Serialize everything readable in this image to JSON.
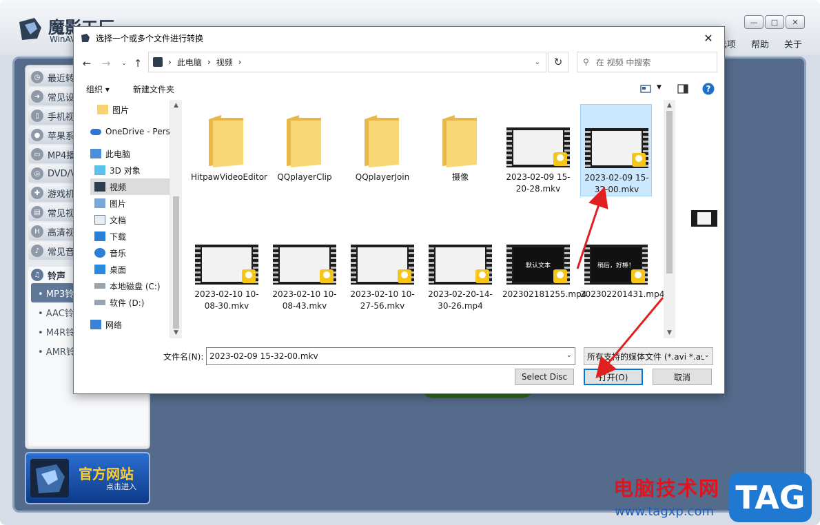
{
  "app": {
    "title": "魔影工厂",
    "subtitle": "WinAV",
    "menu": [
      "选项",
      "帮助",
      "关于"
    ],
    "window_controls": [
      "minimize",
      "maximize",
      "close"
    ],
    "sidebar": [
      {
        "label": "最近转",
        "icon": "clock-icon"
      },
      {
        "label": "常见设",
        "icon": "arrow-icon"
      },
      {
        "label": "手机视",
        "icon": "phone-icon"
      },
      {
        "label": "苹果系",
        "icon": "apple-icon"
      },
      {
        "label": "MP4播",
        "icon": "mp4-icon"
      },
      {
        "label": "DVD/V",
        "icon": "disc-icon"
      },
      {
        "label": "游戏机",
        "icon": "gamepad-icon"
      },
      {
        "label": "常见视",
        "icon": "film-icon"
      },
      {
        "label": "高清视",
        "icon": "hd-icon"
      },
      {
        "label": "常见音",
        "icon": "music-icon"
      }
    ],
    "ringtone_group": {
      "label": "铃声",
      "items": [
        {
          "label": "• MP3铃",
          "active": true
        },
        {
          "label": "• AAC铃",
          "active": false
        },
        {
          "label": "• M4R铃",
          "active": false
        },
        {
          "label": "• AMR铃",
          "active": false
        }
      ]
    },
    "official_site": {
      "title": "官方网站",
      "subtitle": "点击进入"
    }
  },
  "dialog": {
    "title": "选择一个或多个文件进行转换",
    "close_glyph": "✕",
    "address": {
      "crumbs": [
        "此电脑",
        "视频"
      ],
      "separator": "›"
    },
    "search_placeholder": "在 视频 中搜索",
    "toolbar": {
      "organize": "组织 ▾",
      "new_folder": "新建文件夹"
    },
    "nav_pane": [
      {
        "label": "图片",
        "icon": "folder-icon",
        "indent": 1
      },
      {
        "label": "OneDrive - Perso",
        "icon": "cloud-icon",
        "indent": 0
      },
      {
        "label": "此电脑",
        "icon": "computer-icon",
        "indent": 0
      },
      {
        "label": "3D 对象",
        "icon": "cube-icon",
        "indent": 1
      },
      {
        "label": "视频",
        "icon": "video-folder-icon",
        "indent": 1,
        "active": true
      },
      {
        "label": "图片",
        "icon": "picture-folder-icon",
        "indent": 1
      },
      {
        "label": "文档",
        "icon": "document-folder-icon",
        "indent": 1
      },
      {
        "label": "下载",
        "icon": "download-folder-icon",
        "indent": 1
      },
      {
        "label": "音乐",
        "icon": "music-folder-icon",
        "indent": 1
      },
      {
        "label": "桌面",
        "icon": "desktop-folder-icon",
        "indent": 1
      },
      {
        "label": "本地磁盘 (C:)",
        "icon": "drive-c-icon",
        "indent": 1
      },
      {
        "label": "软件 (D:)",
        "icon": "drive-d-icon",
        "indent": 1
      },
      {
        "label": "网络",
        "icon": "network-icon",
        "indent": 0
      }
    ],
    "files": [
      {
        "name": "HitpawVideoEditor",
        "kind": "folder"
      },
      {
        "name": "QQplayerClip",
        "kind": "folder"
      },
      {
        "name": "QQplayerJoin",
        "kind": "folder"
      },
      {
        "name": "摄像",
        "kind": "folder"
      },
      {
        "name": "2023-02-09 15-20-28.mkv",
        "kind": "video"
      },
      {
        "name": "2023-02-09 15-32-00.mkv",
        "kind": "video",
        "selected": true
      },
      {
        "name": "2023-02-10 10-08-30.mkv",
        "kind": "video"
      },
      {
        "name": "2023-02-10 10-08-43.mkv",
        "kind": "video"
      },
      {
        "name": "2023-02-10 10-27-56.mkv",
        "kind": "video"
      },
      {
        "name": "2023-02-20-14-30-26.mp4",
        "kind": "video"
      },
      {
        "name": "202302181255.mp4",
        "kind": "video",
        "thumb_text": "默认文本"
      },
      {
        "name": "202302201431.mp4",
        "kind": "video",
        "thumb_text": "稍后，好棒！"
      },
      {
        "name": "",
        "kind": "play"
      },
      {
        "name": "",
        "kind": "play"
      },
      {
        "name": "",
        "kind": "video"
      },
      {
        "name": "",
        "kind": "video"
      },
      {
        "name": "",
        "kind": "play"
      }
    ],
    "filename_label": "文件名(N):",
    "filename_value": "2023-02-09 15-32-00.mkv",
    "filetype_value": "所有支持的媒体文件 (*.avi *.as",
    "buttons": {
      "select_disc": "Select Disc",
      "open": "打开(O)",
      "cancel": "取消"
    }
  },
  "watermark": {
    "title": "电脑技术网",
    "url": "www.tagxp.com",
    "tag": "TAG"
  },
  "colors": {
    "selection": "#cce8ff",
    "accent": "#0078d7",
    "arrow": "#e02020",
    "play": "#2ec4b6"
  }
}
